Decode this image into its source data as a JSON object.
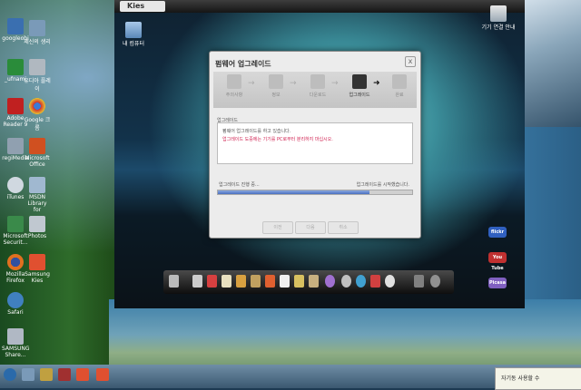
{
  "kies": {
    "tab_label": "Kies",
    "my_computer": "내 컴퓨터",
    "device_disconnect": "기기 연결 안내"
  },
  "dialog": {
    "title": "펌웨어 업그레이드",
    "close_glyph": "x",
    "steps": [
      "주의사항",
      "정보",
      "다운로드",
      "업그레이드",
      "완료"
    ],
    "active_step": 3,
    "section_label": "업그레이드",
    "message_line1": "펌웨어 업그레이드를 하고 있습니다.",
    "message_line2": "업그레이드 도중에는 기기를 PC로부터 분리하지 마십시오.",
    "progress_label": "업그레이드 진행 중...",
    "progress_status": "업그레이드를 시작했습니다.",
    "progress_fraction": 0.78,
    "buttons": [
      "이전",
      "다음",
      "취소"
    ],
    "accent_color": "#d02050"
  },
  "desktop_icons": [
    {
      "label": "googleobi",
      "icon": "app-icon"
    },
    {
      "label": "제신의 생리",
      "icon": "app-icon"
    },
    {
      "label": "_ufnami",
      "icon": "app-icon"
    },
    {
      "label": "유디아 플레이",
      "icon": "app-icon"
    },
    {
      "label": "Adobe Reader 9",
      "icon": "pdf-icon"
    },
    {
      "label": "Google 크롬",
      "icon": "chrome-icon"
    },
    {
      "label": "regiMedia",
      "icon": "app-icon"
    },
    {
      "label": "Microsoft Office",
      "icon": "office-icon"
    },
    {
      "label": "iTunes",
      "icon": "itunes-icon"
    },
    {
      "label": "MSDN Library for",
      "icon": "app-icon"
    },
    {
      "label": "Microsoft Securit...",
      "icon": "app-icon"
    },
    {
      "label": "Photos",
      "icon": "photos-icon"
    },
    {
      "label": "Mozilla Firefox",
      "icon": "firefox-icon"
    },
    {
      "label": "Samsung Kies",
      "icon": "kies-icon"
    },
    {
      "label": "Safari",
      "icon": "safari-icon"
    },
    {
      "label": "SAMSUNG Share...",
      "icon": "app-icon"
    }
  ],
  "right_widgets": [
    "flickr",
    "You Tube",
    "Picasa"
  ],
  "taskbar": {
    "notification": "자기동 사용할 수"
  }
}
